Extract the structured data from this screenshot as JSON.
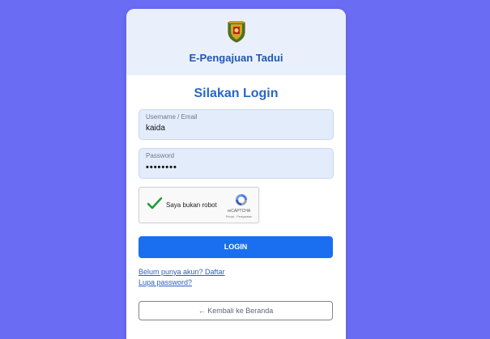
{
  "header": {
    "app_title": "E-Pengajuan Tadui"
  },
  "form": {
    "heading": "Silakan Login",
    "username": {
      "label": "Username / Email",
      "value": "kaida"
    },
    "password": {
      "label": "Password",
      "value": "••••••••"
    },
    "recaptcha": {
      "label": "Saya bukan robot",
      "brand": "reCAPTCHA",
      "links": "Privasi - Persyaratan"
    },
    "login_label": "LOGIN"
  },
  "links": {
    "register": "Belum punya akun? Daftar",
    "forgot": "Lupa password?"
  },
  "back_label": "← Kembali ke Beranda",
  "colors": {
    "background": "#6a6cf4",
    "primary": "#1a6ff0",
    "header_bg": "#eaf0fb",
    "title": "#1f57b4"
  },
  "icons": {
    "logo": "coat-of-arms-logo",
    "check": "check-icon",
    "captcha": "recaptcha-logo-icon"
  }
}
